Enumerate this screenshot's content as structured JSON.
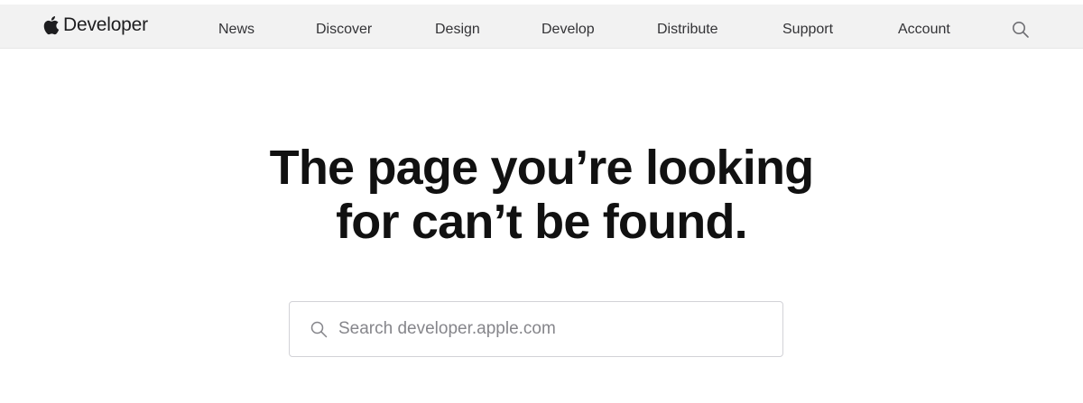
{
  "header": {
    "brand_label": "Developer",
    "nav_items": [
      {
        "label": "News"
      },
      {
        "label": "Discover"
      },
      {
        "label": "Design"
      },
      {
        "label": "Develop"
      },
      {
        "label": "Distribute"
      },
      {
        "label": "Support"
      },
      {
        "label": "Account"
      }
    ],
    "icons": {
      "logo": "apple-logo-icon",
      "search": "search-icon"
    }
  },
  "main": {
    "headline_line1": "The page you’re looking",
    "headline_line2": "for can’t be found.",
    "search": {
      "placeholder": "Search developer.apple.com",
      "value": ""
    }
  },
  "colors": {
    "nav_background": "#f2f2f2",
    "text_primary": "#1d1d1f",
    "placeholder": "#86868b",
    "input_border": "#d2d2d7"
  }
}
